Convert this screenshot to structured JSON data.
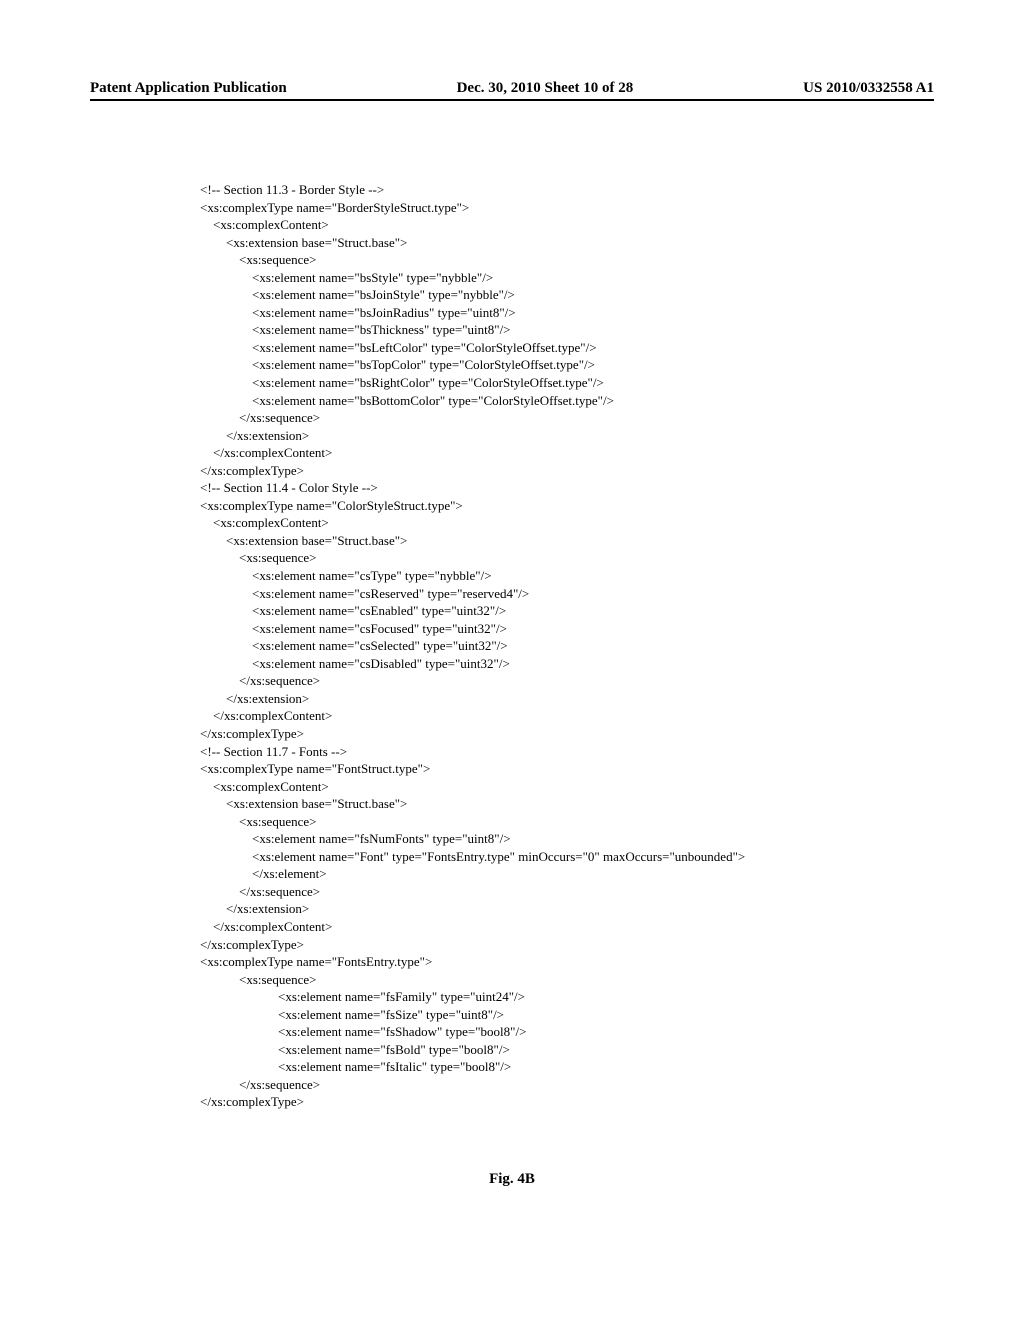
{
  "header": {
    "left": "Patent Application Publication",
    "center": "Dec. 30, 2010   Sheet 10 of 28",
    "right": "US 2010/0332558 A1"
  },
  "code_lines": [
    "<!-- Section 11.3 - Border Style -->",
    "<xs:complexType name=\"BorderStyleStruct.type\">",
    "    <xs:complexContent>",
    "        <xs:extension base=\"Struct.base\">",
    "            <xs:sequence>",
    "                <xs:element name=\"bsStyle\" type=\"nybble\"/>",
    "                <xs:element name=\"bsJoinStyle\" type=\"nybble\"/>",
    "                <xs:element name=\"bsJoinRadius\" type=\"uint8\"/>",
    "                <xs:element name=\"bsThickness\" type=\"uint8\"/>",
    "                <xs:element name=\"bsLeftColor\" type=\"ColorStyleOffset.type\"/>",
    "                <xs:element name=\"bsTopColor\" type=\"ColorStyleOffset.type\"/>",
    "                <xs:element name=\"bsRightColor\" type=\"ColorStyleOffset.type\"/>",
    "                <xs:element name=\"bsBottomColor\" type=\"ColorStyleOffset.type\"/>",
    "            </xs:sequence>",
    "        </xs:extension>",
    "    </xs:complexContent>",
    "</xs:complexType>",
    "<!-- Section 11.4 - Color Style -->",
    "<xs:complexType name=\"ColorStyleStruct.type\">",
    "    <xs:complexContent>",
    "        <xs:extension base=\"Struct.base\">",
    "            <xs:sequence>",
    "                <xs:element name=\"csType\" type=\"nybble\"/>",
    "                <xs:element name=\"csReserved\" type=\"reserved4\"/>",
    "                <xs:element name=\"csEnabled\" type=\"uint32\"/>",
    "                <xs:element name=\"csFocused\" type=\"uint32\"/>",
    "                <xs:element name=\"csSelected\" type=\"uint32\"/>",
    "                <xs:element name=\"csDisabled\" type=\"uint32\"/>",
    "            </xs:sequence>",
    "        </xs:extension>",
    "    </xs:complexContent>",
    "</xs:complexType>",
    "<!-- Section 11.7 - Fonts -->",
    "<xs:complexType name=\"FontStruct.type\">",
    "    <xs:complexContent>",
    "        <xs:extension base=\"Struct.base\">",
    "            <xs:sequence>",
    "                <xs:element name=\"fsNumFonts\" type=\"uint8\"/>",
    "                <xs:element name=\"Font\" type=\"FontsEntry.type\" minOccurs=\"0\" maxOccurs=\"unbounded\">",
    "                </xs:element>",
    "            </xs:sequence>",
    "        </xs:extension>",
    "    </xs:complexContent>",
    "</xs:complexType>",
    "<xs:complexType name=\"FontsEntry.type\">",
    "            <xs:sequence>",
    "                        <xs:element name=\"fsFamily\" type=\"uint24\"/>",
    "                        <xs:element name=\"fsSize\" type=\"uint8\"/>",
    "                        <xs:element name=\"fsShadow\" type=\"bool8\"/>",
    "                        <xs:element name=\"fsBold\" type=\"bool8\"/>",
    "                        <xs:element name=\"fsItalic\" type=\"bool8\"/>",
    "            </xs:sequence>",
    "</xs:complexType>"
  ],
  "figure_caption": "Fig. 4B"
}
